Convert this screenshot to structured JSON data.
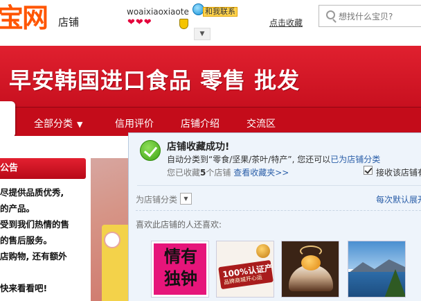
{
  "header": {
    "logo_text": "宝网",
    "logo_sub": "店铺",
    "seller_name": "woaixiaoxiaote",
    "contact_label": "和我联系",
    "hearts": "❤❤❤",
    "favorite_link": "点击收藏",
    "search_placeholder": "想找什么宝贝?"
  },
  "banner": {
    "title": "早安韩国进口食品 零售 批发"
  },
  "nav": {
    "items": [
      {
        "label": "全部分类"
      },
      {
        "label": "信用评价"
      },
      {
        "label": "店铺介绍"
      },
      {
        "label": "交流区"
      }
    ],
    "dropdown_arrow": "▼"
  },
  "sidebar": {
    "notice_title": "公告",
    "notice_lines": [
      "尽提供品质优秀,",
      "的产品。",
      "受到我们热情的售",
      "的售后服务。",
      "店购物, 还有额外",
      "",
      "快来看看吧!"
    ]
  },
  "popup": {
    "title": "店铺收藏成功!",
    "line1_prefix": "自动分类到“零食/坚果/茶叶/特产”, 您还可以",
    "line1_link": "已为店铺分类",
    "line2_prefix": "您已收藏",
    "line2_count": "5",
    "line2_mid": "个店铺",
    "line2_link": "查看收藏夹>>",
    "checkbox_label": "接收该店铺有",
    "category_label": "为店铺分类",
    "settings_link": "每次默认展开",
    "also_like": "喜欢此店铺的人还喜欢:",
    "thumbnails": [
      {
        "text": "情有独钟"
      },
      {
        "text": "100%认证产",
        "sub": "品牌商城开心运"
      },
      {
        "text": ""
      },
      {
        "text": ""
      }
    ]
  }
}
